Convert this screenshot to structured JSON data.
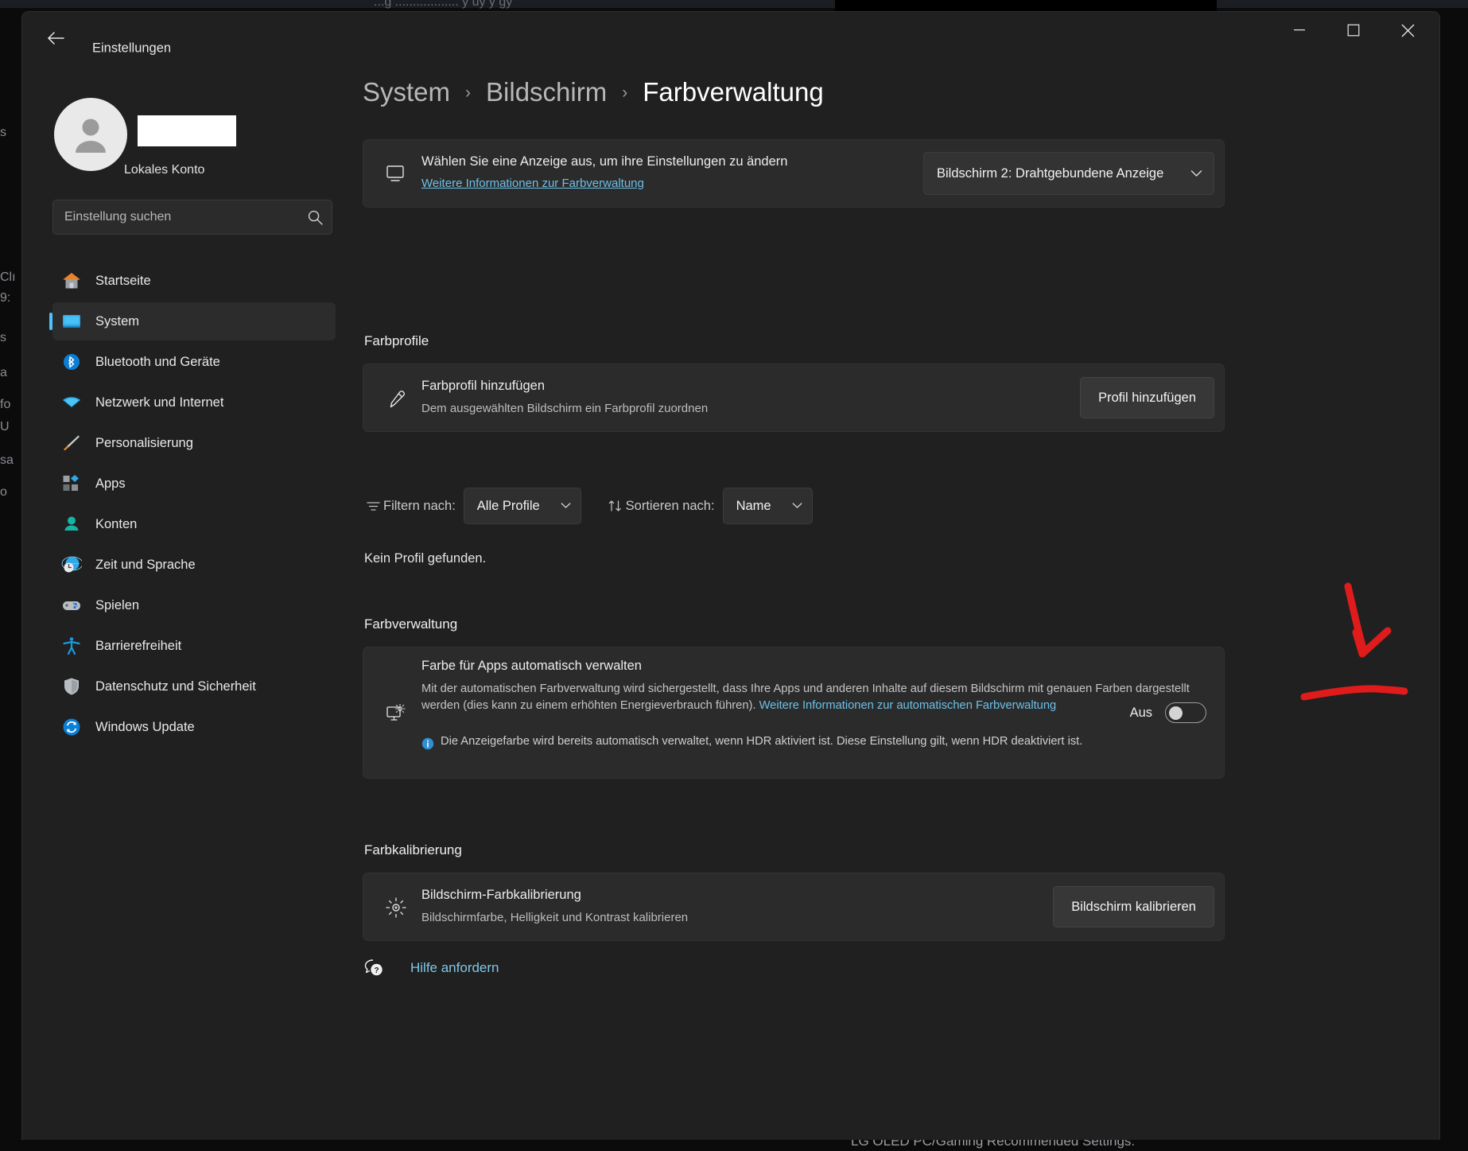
{
  "window": {
    "title": "Einstellungen",
    "back_icon": "back-arrow-icon",
    "minimize_label": "Minimieren",
    "maximize_label": "Maximieren",
    "close_label": "Schließen"
  },
  "sidebar": {
    "account": {
      "name_redacted": "",
      "account_type": "Lokales Konto",
      "avatar_icon": "person-avatar-icon"
    },
    "search": {
      "placeholder": "Einstellung suchen",
      "value": "",
      "icon": "search-icon"
    },
    "items": [
      {
        "label": "Startseite",
        "icon": "home-icon",
        "selected": false
      },
      {
        "label": "System",
        "icon": "monitor-icon",
        "selected": true
      },
      {
        "label": "Bluetooth und Geräte",
        "icon": "bluetooth-icon",
        "selected": false
      },
      {
        "label": "Netzwerk und Internet",
        "icon": "wifi-icon",
        "selected": false
      },
      {
        "label": "Personalisierung",
        "icon": "paintbrush-icon",
        "selected": false
      },
      {
        "label": "Apps",
        "icon": "apps-icon",
        "selected": false
      },
      {
        "label": "Konten",
        "icon": "account-icon",
        "selected": false
      },
      {
        "label": "Zeit und Sprache",
        "icon": "clock-globe-icon",
        "selected": false
      },
      {
        "label": "Spielen",
        "icon": "gamepad-icon",
        "selected": false
      },
      {
        "label": "Barrierefreiheit",
        "icon": "accessibility-icon",
        "selected": false
      },
      {
        "label": "Datenschutz und Sicherheit",
        "icon": "shield-icon",
        "selected": false
      },
      {
        "label": "Windows Update",
        "icon": "update-icon",
        "selected": false
      }
    ]
  },
  "breadcrumb": {
    "items": [
      "System",
      "Bildschirm",
      "Farbverwaltung"
    ],
    "separator": "›"
  },
  "display_card": {
    "icon": "monitor-icon",
    "title": "Wählen Sie eine Anzeige aus, um ihre Einstellungen zu ändern",
    "link": "Weitere Informationen zur Farbverwaltung",
    "select_value": "Bildschirm 2: Drahtgebundene Anzeige",
    "select_chevron": "chevron-down-icon"
  },
  "color_profiles": {
    "heading": "Farbprofile",
    "card": {
      "icon": "eyedropper-icon",
      "title": "Farbprofil hinzufügen",
      "subtitle": "Dem ausgewählten Bildschirm ein Farbprofil zuordnen",
      "button": "Profil hinzufügen"
    },
    "filter": {
      "icon": "filter-icon",
      "label": "Filtern nach:",
      "value": "Alle Profile",
      "chevron": "chevron-down-icon"
    },
    "sort": {
      "icon": "sort-icon",
      "label": "Sortieren nach:",
      "value": "Name",
      "chevron": "chevron-down-icon"
    },
    "empty_state": "Kein Profil gefunden."
  },
  "color_management": {
    "heading": "Farbverwaltung",
    "icon": "display-color-icon",
    "title": "Farbe für Apps automatisch verwalten",
    "description_part1": "Mit der automatischen Farbverwaltung wird sichergestellt, dass Ihre Apps und anderen Inhalte auf diesem Bildschirm mit genauen Farben dargestellt werden (dies kann zu einem erhöhten Energieverbrauch führen). ",
    "description_link": "Weitere Informationen zur automatischen Farbverwaltung",
    "note_icon": "info-icon",
    "note": "Die Anzeigefarbe wird bereits automatisch verwaltet, wenn HDR aktiviert ist. Diese Einstellung gilt, wenn HDR deaktiviert ist.",
    "toggle_state_label": "Aus",
    "toggle_on": false
  },
  "color_calibration": {
    "heading": "Farbkalibrierung",
    "card": {
      "icon": "brightness-icon",
      "title": "Bildschirm-Farbkalibrierung",
      "subtitle": "Bildschirmfarbe, Helligkeit und Kontrast kalibrieren",
      "button": "Bildschirm kalibrieren"
    }
  },
  "help": {
    "icon": "help-question-icon",
    "label": "Hilfe anfordern"
  },
  "annotations": {
    "color": "#e01b1b",
    "arrow_target": "color-management-toggle",
    "underline_target": "color-management-toggle"
  },
  "background": {
    "ghost_title": "...g .................. y uy y gy",
    "left_column": [
      "s",
      "Clı",
      "9:",
      "s",
      "a",
      "fo",
      "U",
      "sa",
      "o"
    ],
    "bottom_text": "LG OLED PC/Gaming Recommended Settings:"
  }
}
